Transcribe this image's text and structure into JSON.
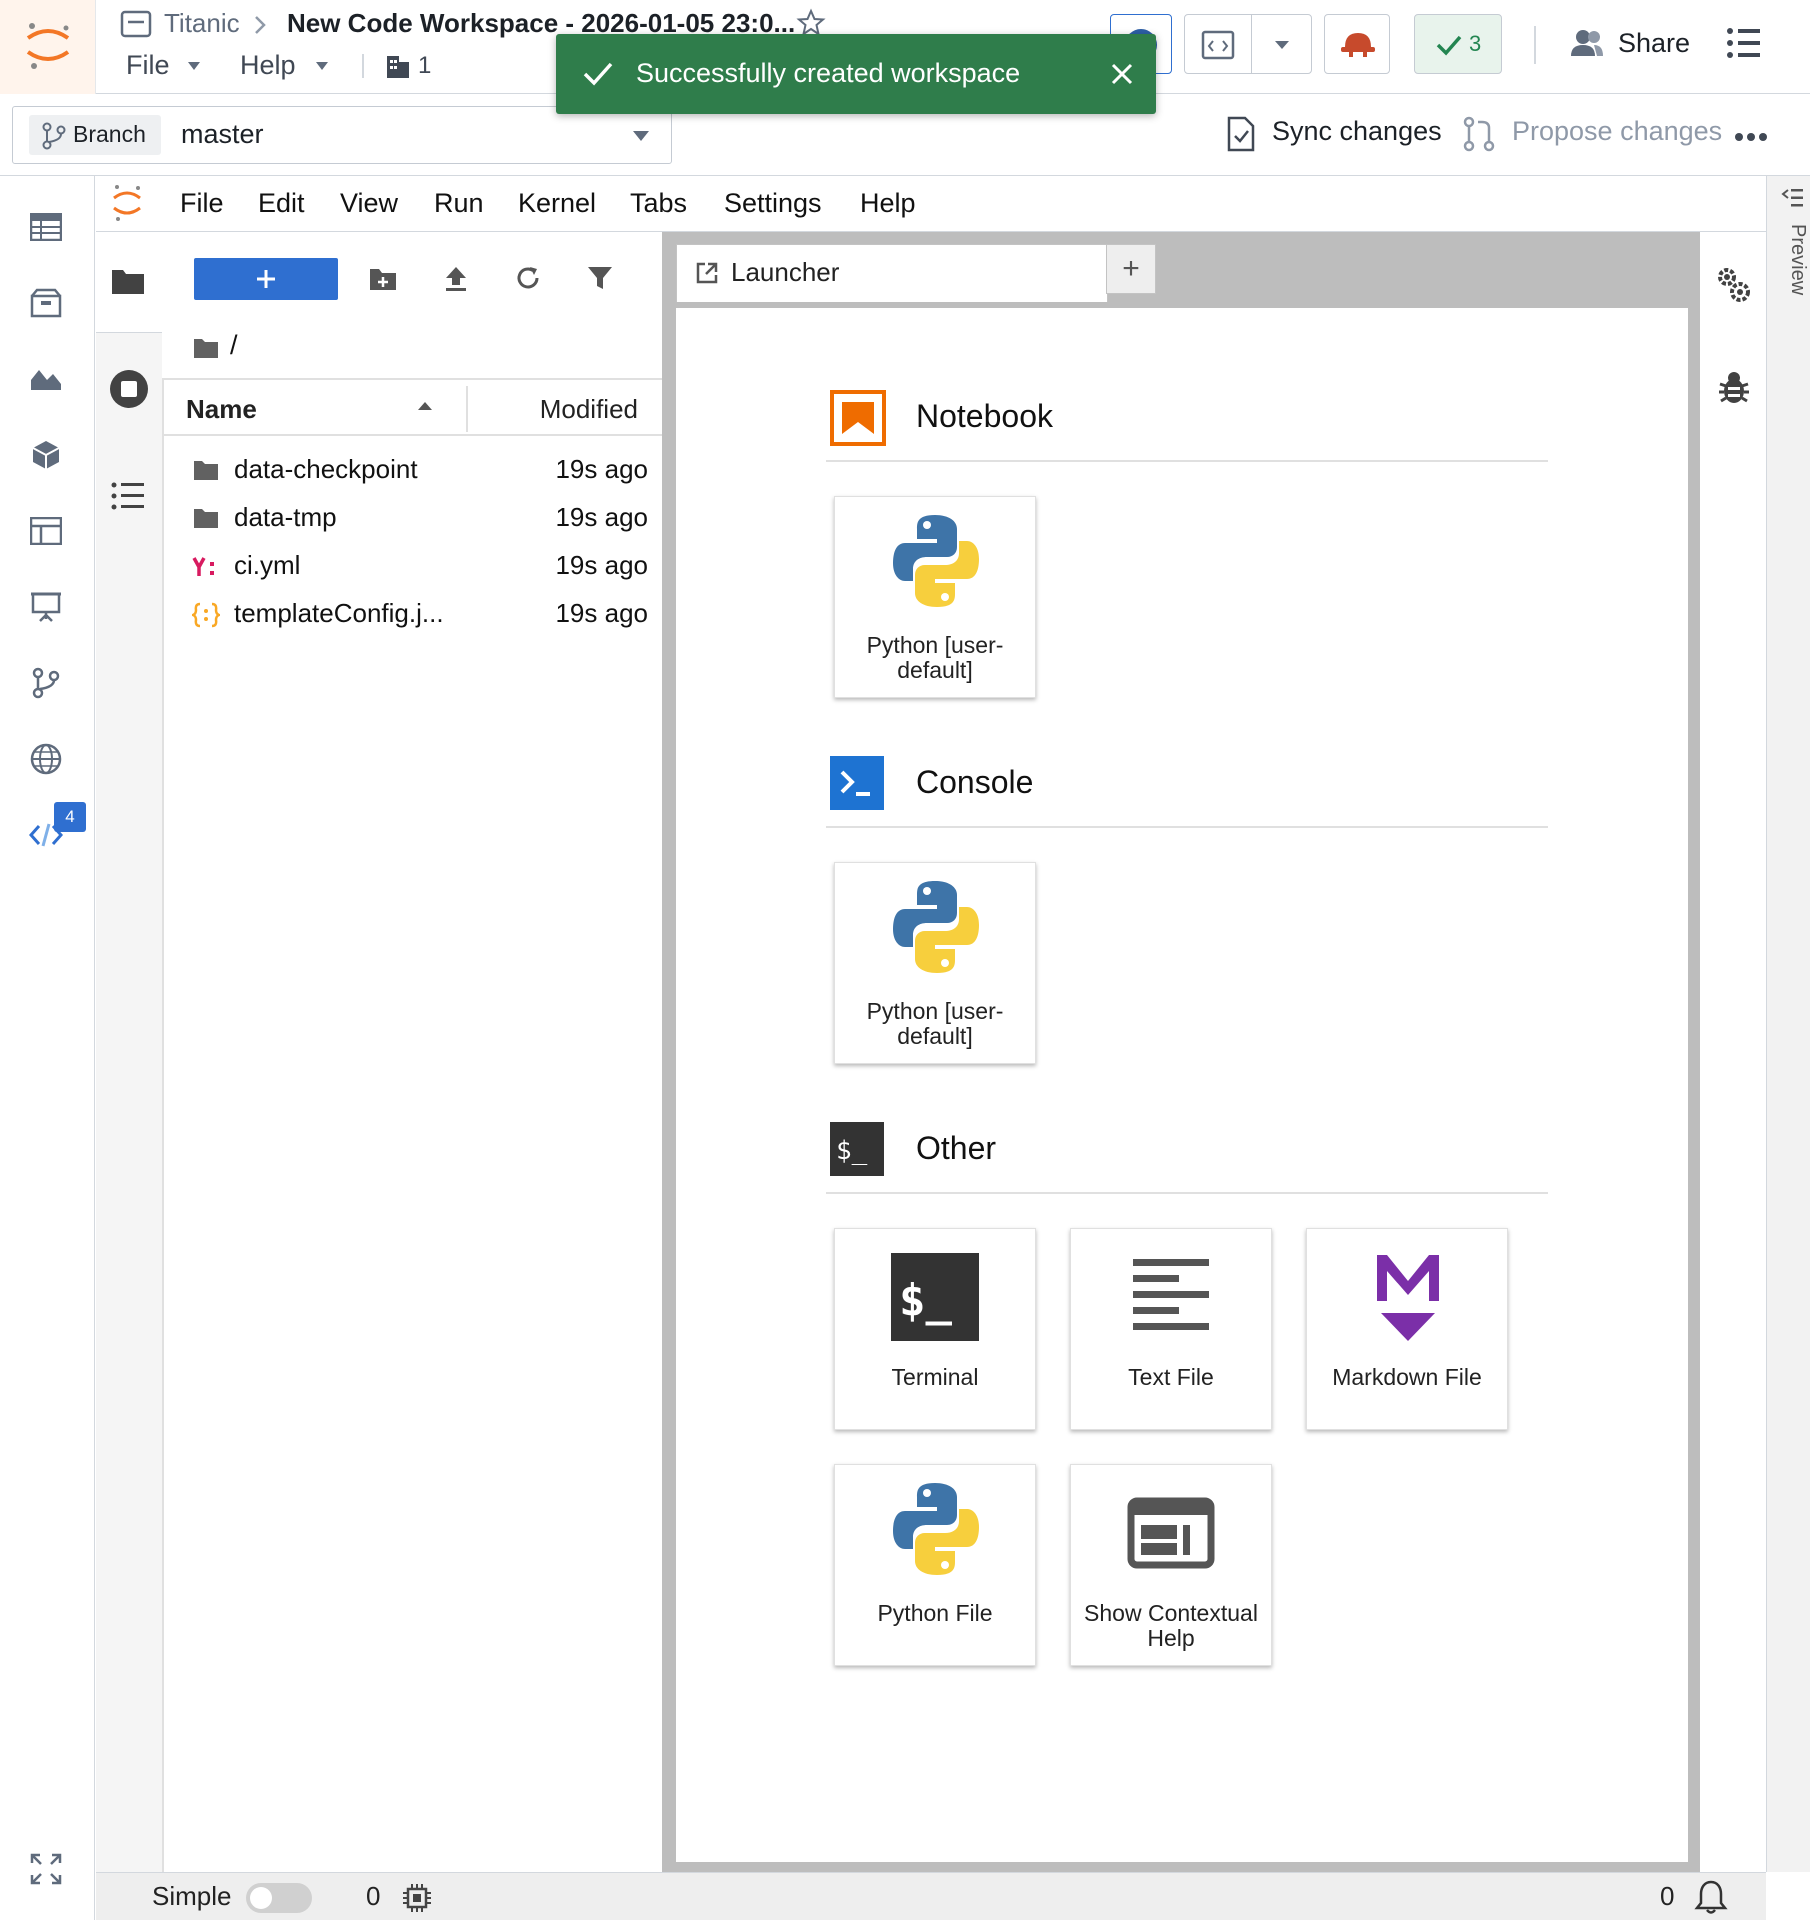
{
  "header": {
    "breadcrumb_parent": "Titanic",
    "workspace_title": "New Code Workspace - 2026-01-05 23:0...",
    "menu_file": "File",
    "menu_help": "Help",
    "building_count": "1",
    "checks_count": "3",
    "share_label": "Share"
  },
  "toast": {
    "message": "Successfully created workspace"
  },
  "branchbar": {
    "branch_tag": "Branch",
    "branch_value": "master",
    "sync_label": "Sync changes",
    "propose_label": "Propose changes"
  },
  "rail": {
    "git_badge": "4"
  },
  "jupyter_menu": {
    "items": [
      "File",
      "Edit",
      "View",
      "Run",
      "Kernel",
      "Tabs",
      "Settings",
      "Help"
    ]
  },
  "file_browser": {
    "path": "/",
    "col_name": "Name",
    "col_modified": "Modified",
    "files": [
      {
        "name": "data-checkpoint",
        "modified": "19s ago",
        "type": "folder"
      },
      {
        "name": "data-tmp",
        "modified": "19s ago",
        "type": "folder"
      },
      {
        "name": "ci.yml",
        "modified": "19s ago",
        "type": "yaml"
      },
      {
        "name": "templateConfig.j...",
        "modified": "19s ago",
        "type": "json"
      }
    ]
  },
  "tabs": {
    "launcher_label": "Launcher",
    "add_label": "+"
  },
  "launcher": {
    "notebook_title": "Notebook",
    "console_title": "Console",
    "other_title": "Other",
    "notebook_card": "Python [user-default]",
    "console_card": "Python [user-default]",
    "terminal_card": "Terminal",
    "textfile_card": "Text File",
    "markdown_card": "Markdown File",
    "pythonfile_card": "Python File",
    "help_card": "Show Contextual Help"
  },
  "right_strip": {
    "preview_label": "Preview"
  },
  "statusbar": {
    "mode_label": "Simple",
    "terminals_count": "0",
    "notifications_count": "0"
  },
  "colors": {
    "accent_blue": "#2f6fd0",
    "toast_green": "#2f7d4b",
    "brand_orange": "#f37726",
    "markdown_purple": "#7b2fa8"
  }
}
